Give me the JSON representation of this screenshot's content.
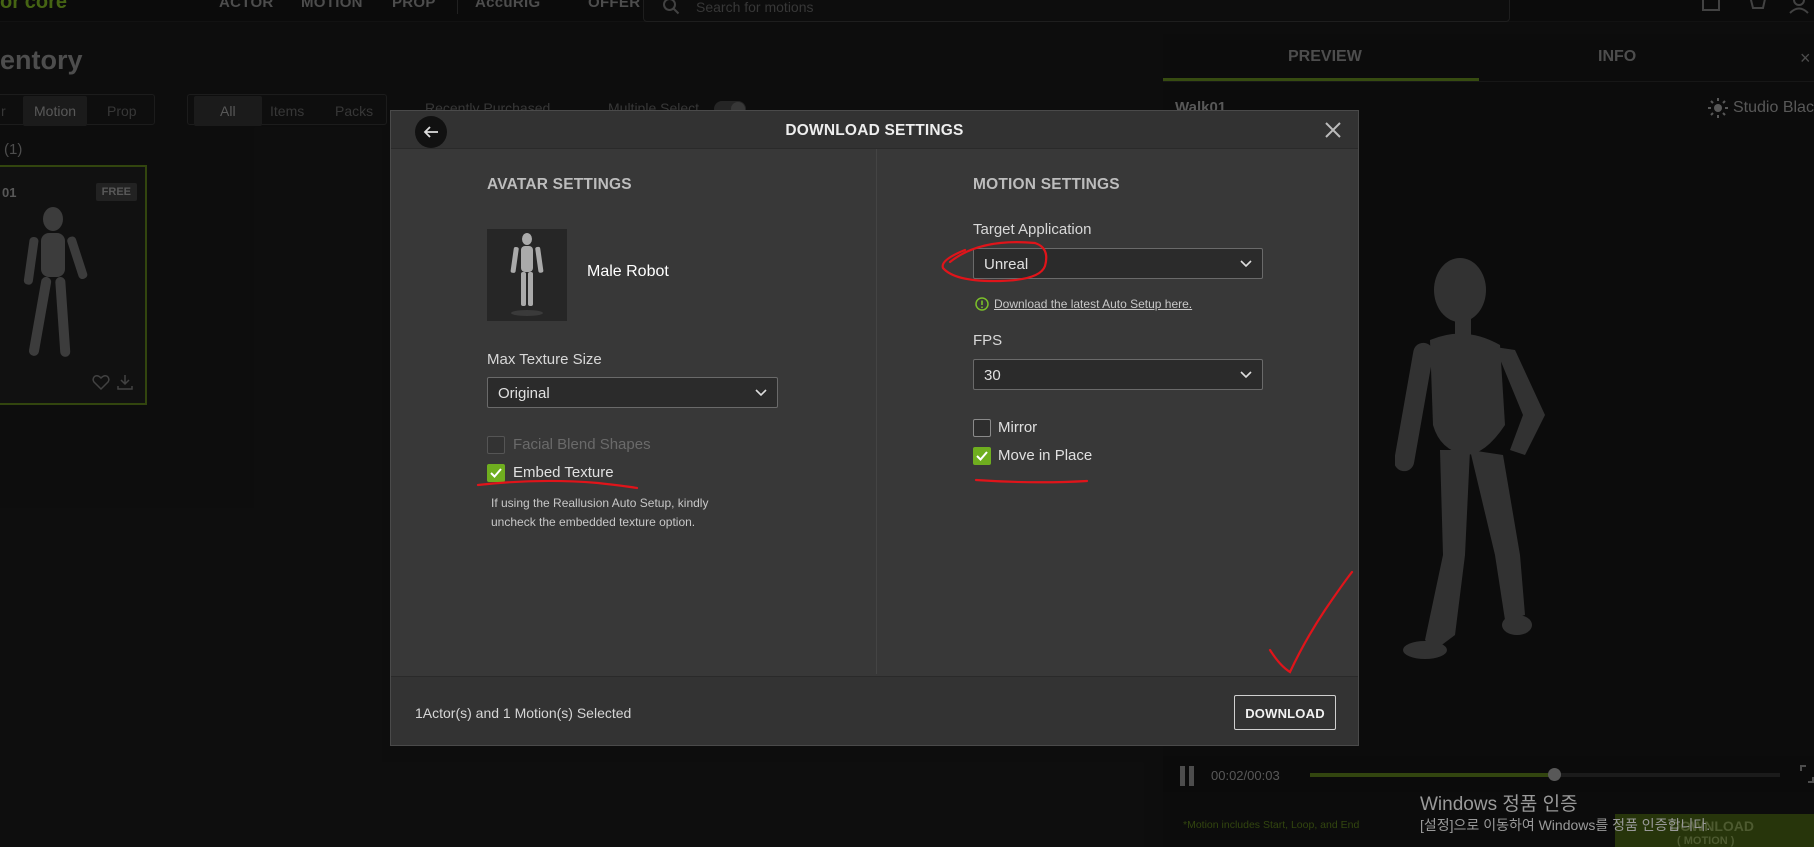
{
  "app": {
    "logo": "or'core",
    "nav": [
      "ACTOR",
      "MOTION",
      "PROP",
      "AccuRIG",
      "OFFER"
    ],
    "search_placeholder": "Search for motions"
  },
  "inventory": {
    "title": "entory",
    "type_tabs": [
      "r",
      "Motion",
      "Prop"
    ],
    "active_type": "Motion",
    "filter_tabs": [
      "All",
      "Items",
      "Packs"
    ],
    "active_filter": "All",
    "sort_label": "Recently Purchased",
    "multi_select_label": "Multiple Select",
    "count": "(1)",
    "card": {
      "id": "01",
      "badge": "FREE"
    }
  },
  "preview": {
    "tabs": [
      "PREVIEW",
      "INFO"
    ],
    "active_tab": "PREVIEW",
    "close": "×",
    "motion_name": "Walk01",
    "environment": "Studio Black",
    "time": "00:02/00:03",
    "progress": 0.52,
    "note": "*Motion includes Start, Loop, and End",
    "download_label": "DOWNLOAD",
    "download_sub": "( MOTION )"
  },
  "windows": {
    "line1": "Windows 정품 인증",
    "line2": "[설정]으로 이동하여 Windows를 정품 인증합니다."
  },
  "modal": {
    "title": "DOWNLOAD SETTINGS",
    "avatar": {
      "section_title": "AVATAR SETTINGS",
      "name": "Male Robot",
      "max_texture_label": "Max Texture Size",
      "max_texture_value": "Original",
      "facial_blend_label": "Facial Blend Shapes",
      "facial_blend_checked": false,
      "embed_texture_label": "Embed Texture",
      "embed_texture_checked": true,
      "hint": "If using the Reallusion Auto Setup, kindly uncheck the embedded texture option."
    },
    "motion": {
      "section_title": "MOTION SETTINGS",
      "target_label": "Target Application",
      "target_value": "Unreal",
      "auto_setup_link": "Download the latest Auto Setup here.",
      "fps_label": "FPS",
      "fps_value": "30",
      "mirror_label": "Mirror",
      "mirror_checked": false,
      "move_in_place_label": "Move in Place",
      "move_in_place_checked": true
    },
    "footer": {
      "selection_text": "1Actor(s) and 1 Motion(s) Selected",
      "download_button": "DOWNLOAD"
    }
  },
  "colors": {
    "accent_green": "#6fae1f",
    "annotation_red": "#e0141a"
  }
}
